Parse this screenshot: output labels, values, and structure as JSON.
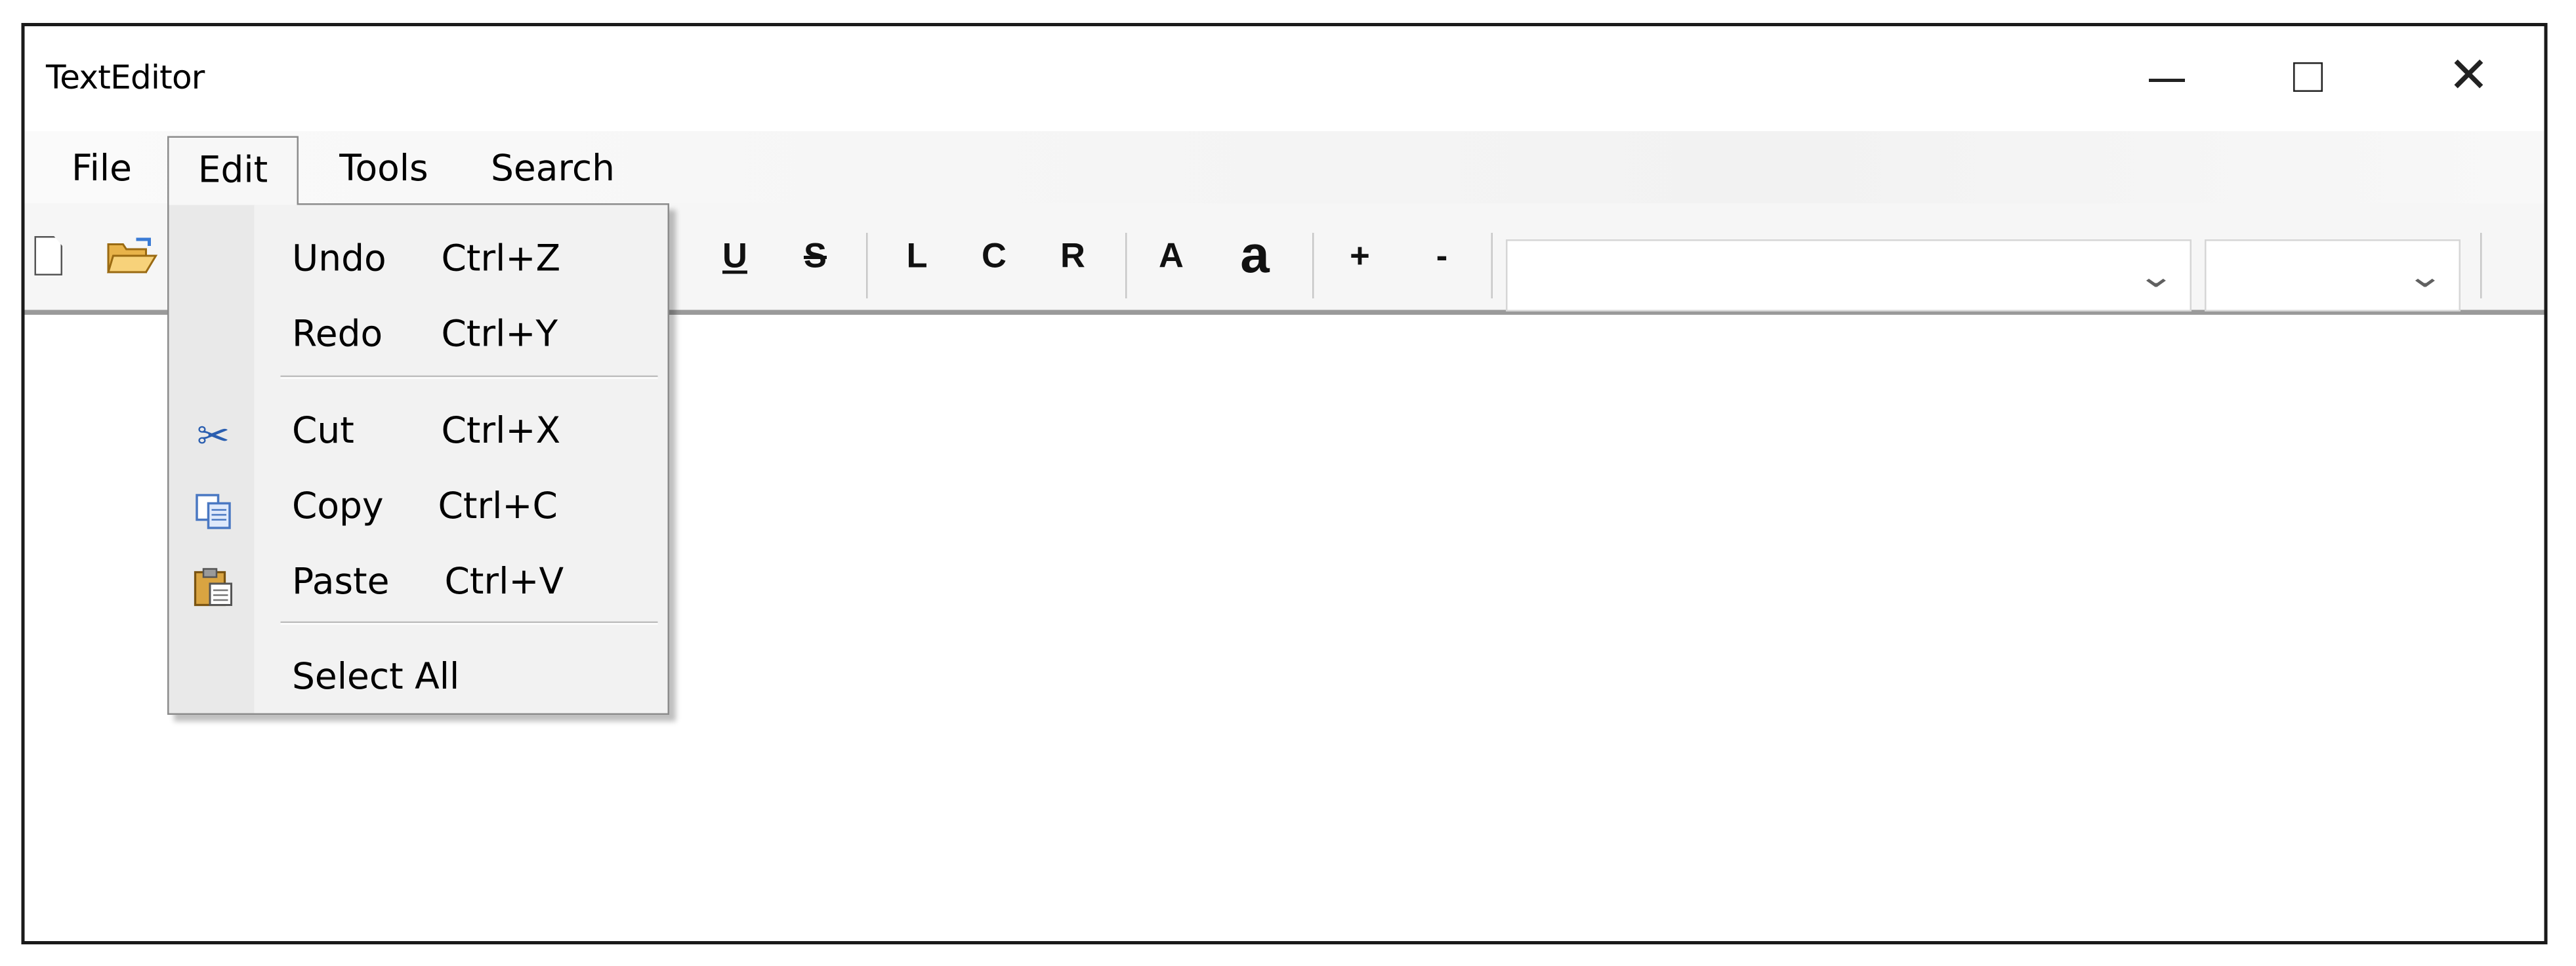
{
  "window": {
    "title": "TextEditor"
  },
  "menubar": {
    "items": [
      "File",
      "Edit",
      "Tools",
      "Search"
    ]
  },
  "toolbar": {
    "underline_label": "U",
    "strike_label": "S",
    "align_left_label": "L",
    "align_center_label": "C",
    "align_right_label": "R",
    "font_small_label": "A",
    "font_large_label": "a",
    "size_increase_label": "+",
    "size_decrease_label": "-",
    "font_combo_value": "",
    "size_combo_value": ""
  },
  "edit_menu": {
    "items": [
      {
        "label": "Undo",
        "shortcut": "Ctrl+Z",
        "icon": ""
      },
      {
        "label": "Redo",
        "shortcut": "Ctrl+Y",
        "icon": ""
      },
      {
        "label": "Cut",
        "shortcut": "Ctrl+X",
        "icon": "scissors-icon"
      },
      {
        "label": "Copy",
        "shortcut": "Ctrl+C",
        "icon": "copy-icon"
      },
      {
        "label": "Paste",
        "shortcut": "Ctrl+V",
        "icon": "paste-icon"
      },
      {
        "label": "Select All",
        "shortcut": "",
        "icon": ""
      }
    ]
  },
  "colors": {
    "window_border": "#1a1a1a",
    "menu_background": "#f2f2f2",
    "menu_gutter": "#e9e9e9",
    "toolbar_background": "#f6f6f6"
  }
}
